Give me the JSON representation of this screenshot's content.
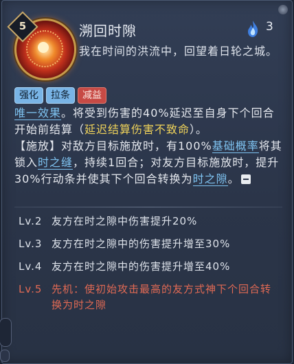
{
  "skill": {
    "cost": "5",
    "name": "溯回时隙",
    "fire_count": "3",
    "flavor": "我在时间的洪流中，回望着日轮之城。"
  },
  "tags": [
    "强化",
    "拉条",
    "减益"
  ],
  "description": {
    "unique_effect": "唯一效果",
    "p1_a": "。将受到伤害的40%延迟至自身下个回合开始前结算（",
    "p1_b": "延迟结算伤害不致命",
    "p1_c": "）。",
    "p2_a": "【施放】对敌方目标施放时，有100%",
    "base_chance": "基础概率",
    "p2_b": "将其锁入",
    "time_seam": "时之缝",
    "p2_c": "，持续1回合；对友方目标施放时，提升30%行动条并使其下个回合转换为",
    "time_gap": "时之隙",
    "p2_d": "。"
  },
  "levels": [
    {
      "lv": "Lv.2",
      "text": "友方在时之隙中伤害提升20%"
    },
    {
      "lv": "Lv.3",
      "text": "友方在时之隙中的伤害提升增至30%"
    },
    {
      "lv": "Lv.4",
      "text": "友方在时之隙中的伤害提升增至40%"
    },
    {
      "lv": "Lv.5",
      "text": "先机：使初始攻击最高的友方式神下个回合转换为时之隙"
    }
  ],
  "colors": {
    "panel": "#2e3a50",
    "highlight_blue": "#7fc4f2",
    "highlight_yellow": "#f0d35a",
    "lv5_red": "#e26a54",
    "tag_blue": "#79b4e6",
    "tag_red": "#c74a45"
  }
}
